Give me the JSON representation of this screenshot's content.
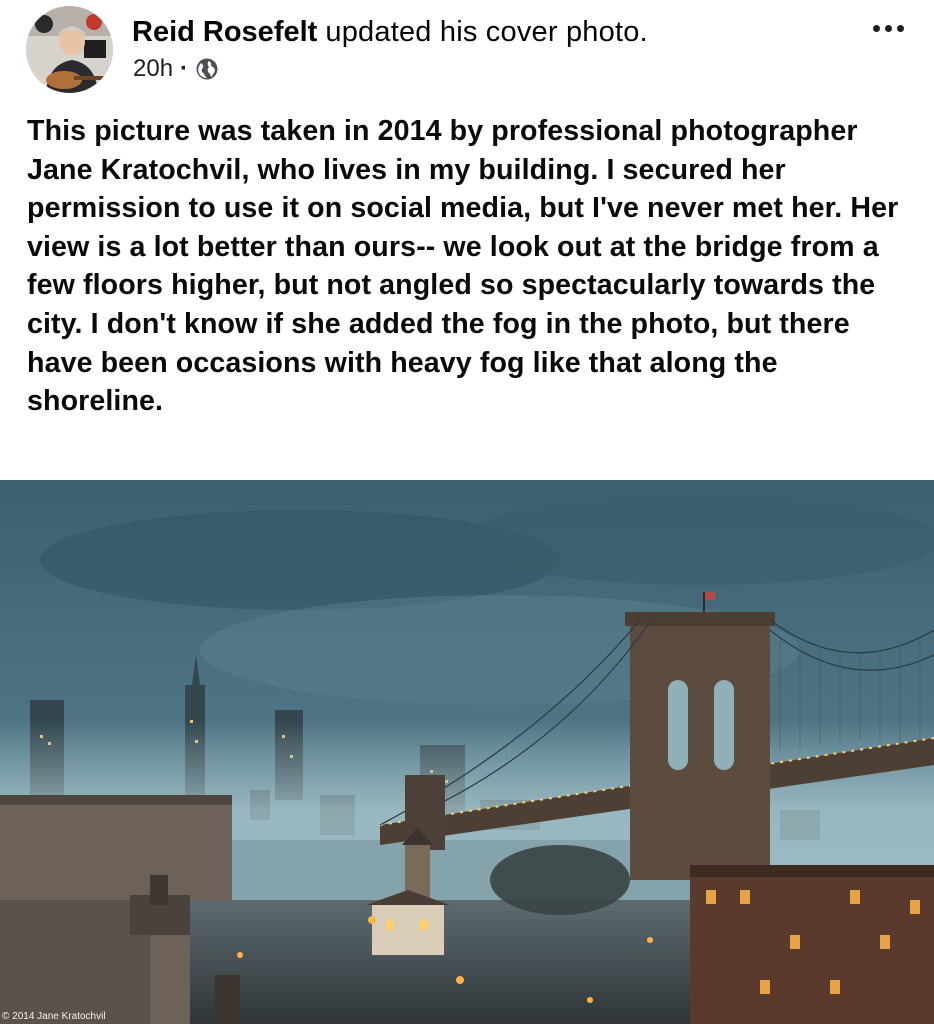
{
  "post": {
    "author": "Reid Rosefelt",
    "action": "updated his cover photo.",
    "time": "20h",
    "separator": "·",
    "audience_icon": "globe-icon",
    "more_icon": "more-options-icon",
    "text": "This picture was taken in 2014 by professional photographer Jane Kratochvil, who lives in my building. I secured her permission to use it on social media, but I've never met her. Her view is a lot better than ours-- we look out at the bridge from a few floors higher, but not angled so spectacularly towards the city. I don't know if she added the fog in the photo, but there have been occasions with heavy fog like that along the shoreline."
  },
  "photo": {
    "credit": "© 2014 Jane Kratochvil"
  },
  "colors": {
    "text": "#050505",
    "sky": "#3f6678",
    "fog": "#9fbfc8",
    "bridge": "#5a4a3e",
    "lights": "#ffd27a"
  }
}
